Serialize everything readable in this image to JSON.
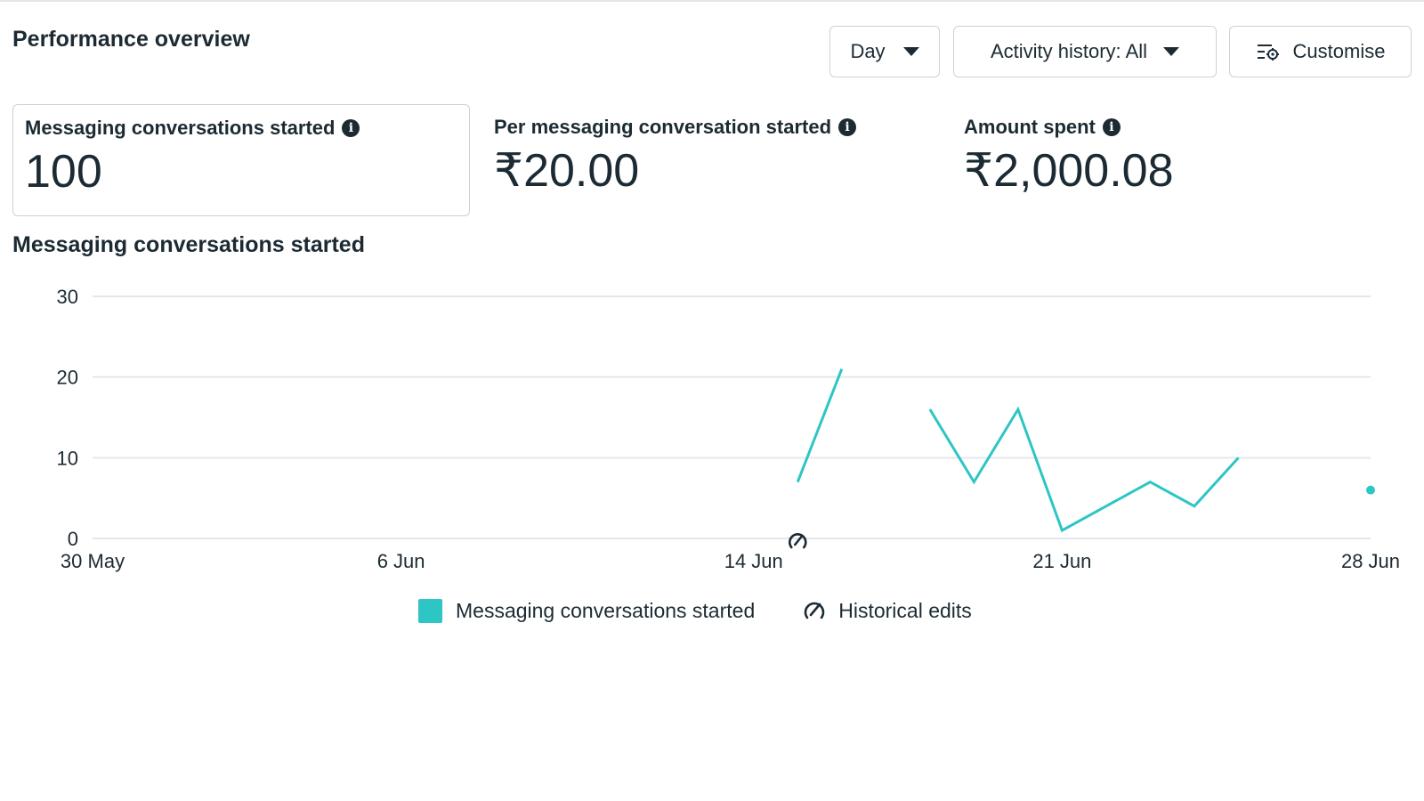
{
  "header": {
    "title": "Performance overview",
    "day_button": "Day",
    "activity_button": "Activity history: All",
    "customise_button": "Customise"
  },
  "metrics": [
    {
      "label": "Messaging conversations started",
      "value": "100",
      "selected": true
    },
    {
      "label": "Per messaging conversation started",
      "value": "₹20.00",
      "selected": false
    },
    {
      "label": "Amount spent",
      "value": "₹2,000.08",
      "selected": false
    }
  ],
  "chart_section": {
    "title": "Messaging conversations started"
  },
  "legend": {
    "series_label": "Messaging conversations started",
    "edits_label": "Historical edits"
  },
  "colors": {
    "series": "#2ec5c5",
    "text": "#1c2b33",
    "grid": "#e4e6eb"
  },
  "chart_data": {
    "type": "line",
    "title": "Messaging conversations started",
    "xlabel": "",
    "ylabel": "",
    "ylim": [
      0,
      30
    ],
    "yticks": [
      0,
      10,
      20,
      30
    ],
    "x_tick_labels": [
      {
        "day": 0,
        "label": "30 May"
      },
      {
        "day": 7,
        "label": "6 Jun"
      },
      {
        "day": 15,
        "label": "14 Jun"
      },
      {
        "day": 22,
        "label": "21 Jun"
      },
      {
        "day": 29,
        "label": "28 Jun"
      }
    ],
    "series": [
      {
        "name": "Messaging conversations started",
        "segments": [
          [
            {
              "day": 16,
              "y": 7
            },
            {
              "day": 17,
              "y": 21
            }
          ],
          [
            {
              "day": 19,
              "y": 16
            },
            {
              "day": 20,
              "y": 7
            },
            {
              "day": 21,
              "y": 16
            },
            {
              "day": 22,
              "y": 1
            },
            {
              "day": 23,
              "y": 4
            },
            {
              "day": 24,
              "y": 7
            },
            {
              "day": 25,
              "y": 4
            },
            {
              "day": 26,
              "y": 10
            }
          ],
          [
            {
              "day": 29,
              "y": 6
            }
          ]
        ]
      }
    ],
    "historical_edits": [
      {
        "day": 16
      }
    ],
    "grid": true,
    "legend_position": "bottom-center"
  }
}
